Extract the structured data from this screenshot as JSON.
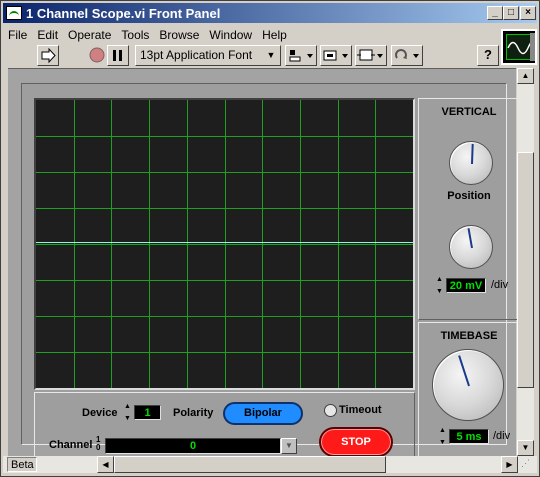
{
  "window": {
    "title": "1 Channel Scope.vi Front Panel",
    "minimize": "_",
    "maximize": "□",
    "close": "×"
  },
  "menu": [
    "File",
    "Edit",
    "Operate",
    "Tools",
    "Browse",
    "Window",
    "Help"
  ],
  "toolbar": {
    "font": "13pt Application Font",
    "help": "?"
  },
  "vertical": {
    "title": "VERTICAL",
    "position_label": "Position",
    "volts_value": "20 mV",
    "volts_unit": "/div"
  },
  "timebase": {
    "title": "TIMEBASE",
    "value": "5 ms",
    "unit": "/div"
  },
  "controls": {
    "device_label": "Device",
    "device_value": "1",
    "polarity_label": "Polarity",
    "polarity_value": "Bipolar",
    "timeout_label": "Timeout",
    "stop_label": "STOP",
    "channel_label": "Channel",
    "channel_value": "0"
  },
  "statusbar": {
    "label": "Beta"
  },
  "colors": {
    "grid": "#1fa01f",
    "trace": "#7fffd4",
    "graph_bg": "#1e1e1e",
    "stop": "#ff1a1a",
    "polarity": "#1f8cff"
  }
}
